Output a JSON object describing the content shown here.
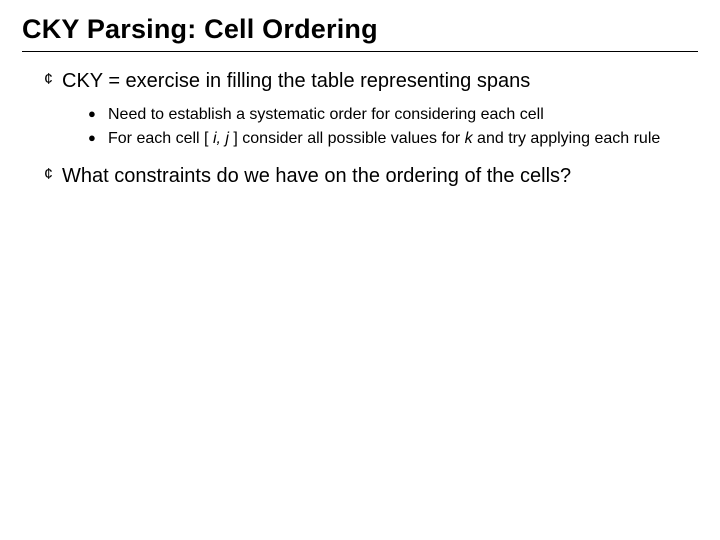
{
  "title": "CKY Parsing: Cell Ordering",
  "bullets": {
    "b1": "CKY = exercise in filling the table representing spans",
    "b1_sub1": "Need to establish a systematic order for considering each cell",
    "b1_sub2_a": "For each cell [ ",
    "b1_sub2_i": "i, j",
    "b1_sub2_b": " ] consider all possible values for ",
    "b1_sub2_k": "k",
    "b1_sub2_c": " and try applying each rule",
    "b2": "What constraints do we have on the ordering of the cells?"
  },
  "glyphs": {
    "hollow_square": "¢",
    "disc": "●"
  }
}
